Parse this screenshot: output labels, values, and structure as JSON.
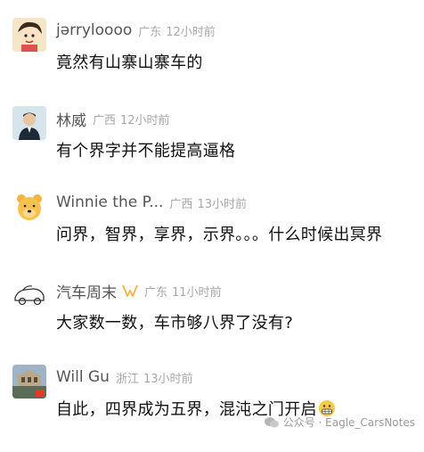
{
  "comments": [
    {
      "name": "jərryloooo",
      "location": "广东",
      "time": "12小时前",
      "text": "竟然有山寨山寨车的",
      "avatar": "cartoon-girl-avatar"
    },
    {
      "name": "林威",
      "location": "广西",
      "time": "12小时前",
      "text": "有个界字并不能提高逼格",
      "avatar": "man-in-suit-avatar"
    },
    {
      "name": "Winnie the P...",
      "location": "广西",
      "time": "13小时前",
      "text": "问界，智界，享界，示界。。。什么时候出冥界",
      "avatar": "winnie-the-pooh-avatar"
    },
    {
      "name": "汽车周末",
      "location": "广东",
      "time": "11小时前",
      "text": "大家数一数，车市够八界了没有?",
      "avatar": "sketch-car-avatar"
    },
    {
      "name": "Will Gu",
      "location": "浙江",
      "time": "13小时前",
      "text": "自此，四界成为五界，混沌之门开启",
      "avatar": "building-photo-avatar"
    }
  ],
  "watermark": {
    "label": "公众号 · Eagle_CarsNotes"
  },
  "colors": {
    "name": "#555555",
    "meta": "#a8a8a8",
    "text": "#111111",
    "badge": "#f0b34a"
  }
}
